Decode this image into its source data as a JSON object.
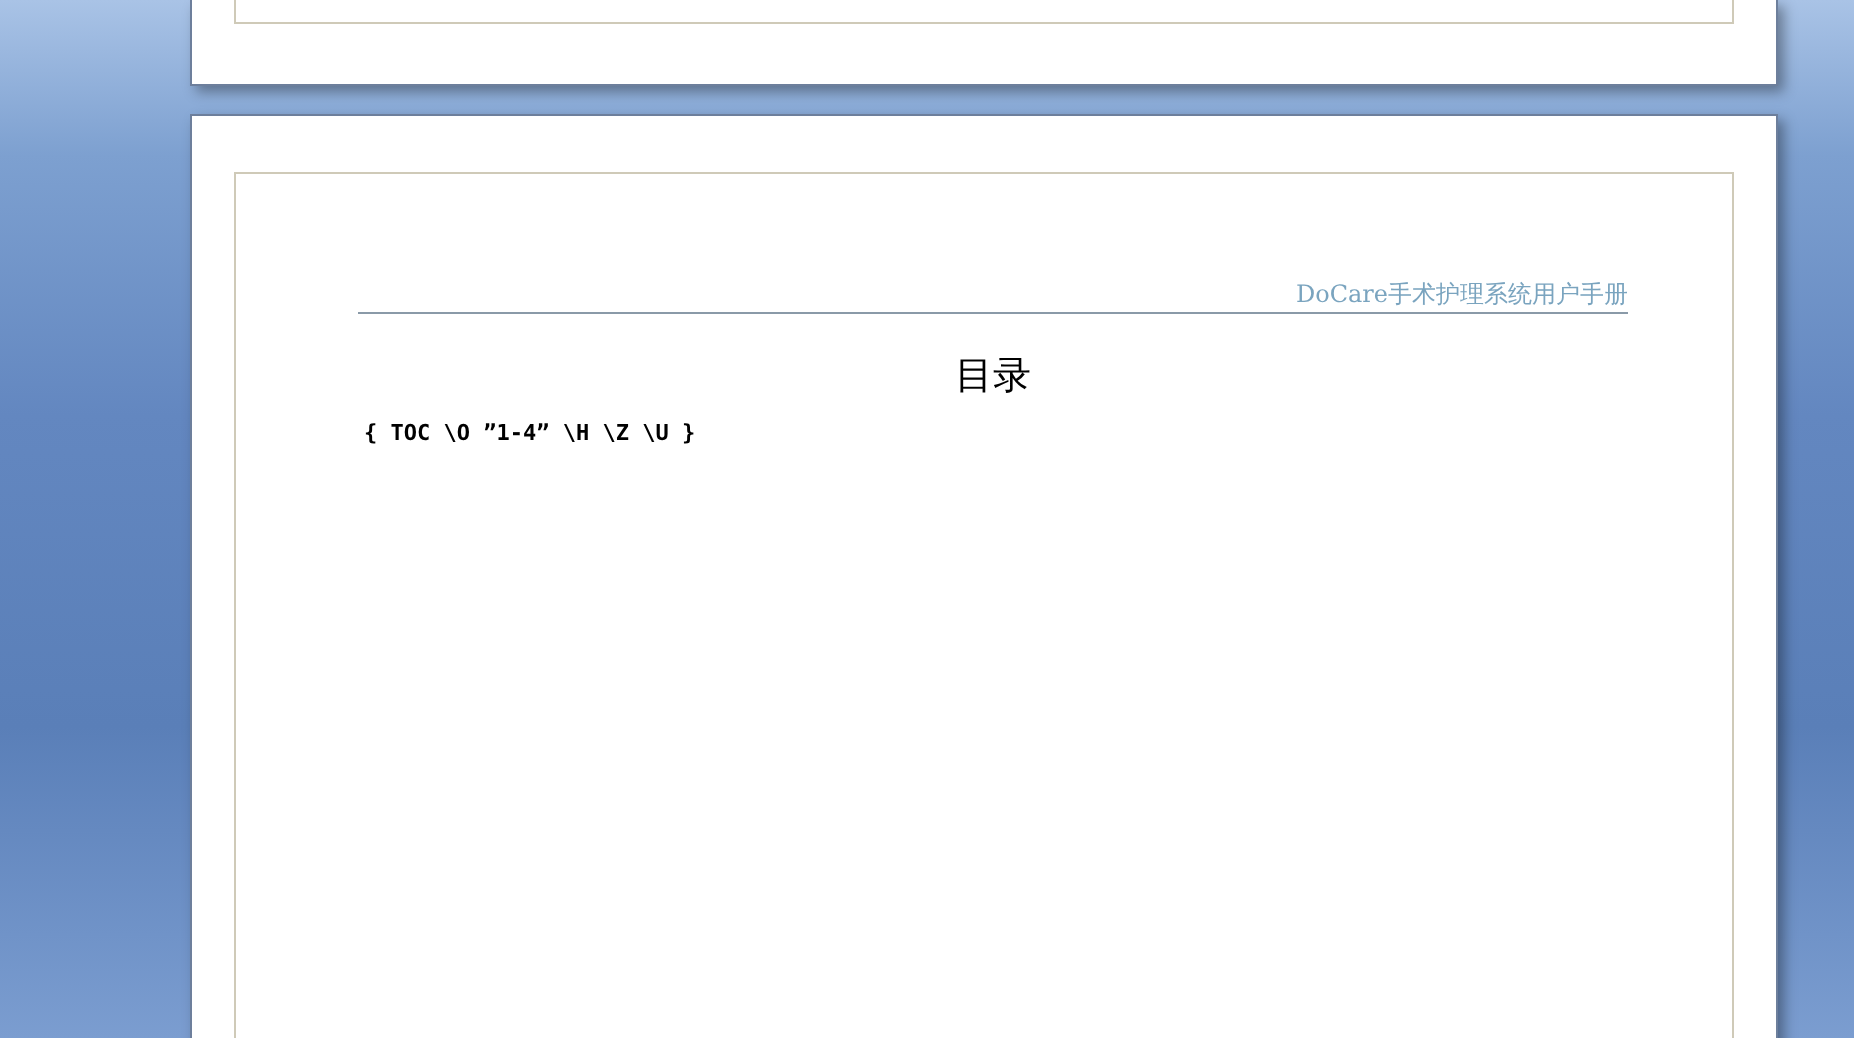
{
  "document": {
    "header": "DoCare手术护理系统用户手册",
    "title": "目录",
    "field_code": "{ TOC \\O ”1-4” \\H \\Z \\U }"
  }
}
